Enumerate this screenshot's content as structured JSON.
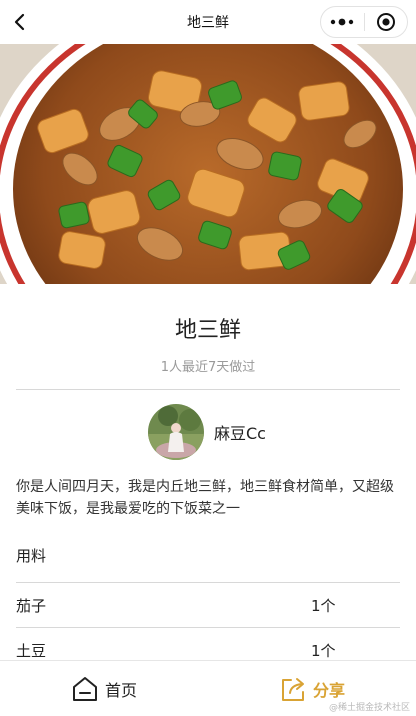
{
  "navbar": {
    "title": "地三鲜",
    "back_icon": "chevron-left-icon",
    "more_icon": "more-dots-icon",
    "close_icon": "target-circle-icon"
  },
  "hero": {
    "alt": "地三鲜 dish photo"
  },
  "recipe": {
    "title": "地三鲜",
    "stats": "1人最近7天做过",
    "author": {
      "name": "麻豆Cc"
    },
    "description": "你是人间四月天，我是内丘地三鲜，地三鲜食材简单，又超级美味下饭，是我最爱吃的下饭菜之一"
  },
  "ingredients": {
    "label": "用料",
    "items": [
      {
        "name": "茄子",
        "qty": "1个"
      },
      {
        "name": "土豆",
        "qty": "1个"
      }
    ]
  },
  "tabbar": {
    "home_label": "首页",
    "share_label": "分享",
    "share_color": "#d9a334"
  },
  "watermark": "@稀土掘金技术社区"
}
